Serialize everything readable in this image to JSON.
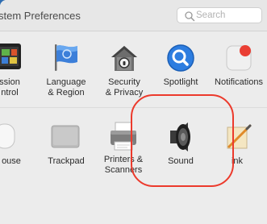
{
  "window": {
    "title": "stem Preferences",
    "search_placeholder": "Search"
  },
  "row1": [
    {
      "name": "mission-control",
      "label_lines": [
        "ssion",
        "ntrol"
      ]
    },
    {
      "name": "language-region",
      "label_lines": [
        "Language",
        "& Region"
      ]
    },
    {
      "name": "security-privacy",
      "label_lines": [
        "Security",
        "& Privacy"
      ]
    },
    {
      "name": "spotlight",
      "label_lines": [
        "Spotlight"
      ]
    },
    {
      "name": "notifications",
      "label_lines": [
        "Notifications"
      ]
    }
  ],
  "row2": [
    {
      "name": "mouse",
      "label_lines": [
        "ouse"
      ]
    },
    {
      "name": "trackpad",
      "label_lines": [
        "Trackpad"
      ]
    },
    {
      "name": "printers-scanners",
      "label_lines": [
        "Printers &",
        "Scanners"
      ]
    },
    {
      "name": "sound",
      "label_lines": [
        "Sound"
      ]
    },
    {
      "name": "ink",
      "label_lines": [
        "ink"
      ]
    }
  ],
  "icons": {
    "mission_control": "mission-control-icon",
    "language_region": "flag-icon",
    "security_privacy": "house-lock-icon",
    "spotlight": "magnifier-icon",
    "notifications": "notifications-icon",
    "mouse": "mouse-icon",
    "trackpad": "trackpad-icon",
    "printers_scanners": "printer-icon",
    "sound": "speaker-icon",
    "ink": "pen-icon"
  },
  "colors": {
    "desktop": "#2f6db1",
    "highlight": "#ec3a2c"
  }
}
